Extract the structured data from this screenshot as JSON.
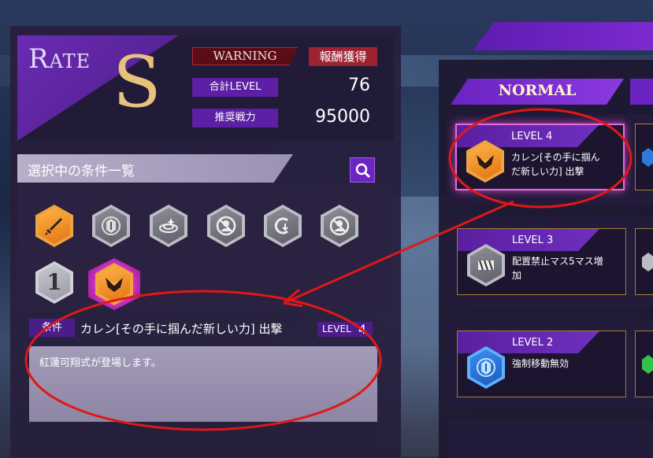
{
  "rate": {
    "label": "Rate",
    "value": "S"
  },
  "warning": "WARNING",
  "reward_button": "報酬獲得",
  "stats": {
    "total_level_label": "合計LEVEL",
    "total_level_value": "76",
    "recommended_power_label": "推奨戦力",
    "recommended_power_value": "95000"
  },
  "conditions": {
    "header": "選択中の条件一覧",
    "icons": [
      "sword-icon",
      "shield-block-icon",
      "swirl-icon",
      "no-unit-icon",
      "recall-icon",
      "no-unit-icon",
      "number-one-icon",
      "guren-icon"
    ],
    "one_label": "1"
  },
  "detail": {
    "tag": "条件",
    "name": "カレン[その手に掴んだ新しい力] 出撃",
    "level_label": "LEVEL",
    "level_value": "4",
    "description": "紅蓮可翔式が登場します。"
  },
  "right": {
    "tab": "NORMAL",
    "cards": [
      {
        "level": "LEVEL 4",
        "text_line1": "カレン[その手に掴ん",
        "text_line2": "だ新しい力] 出撃",
        "icon": "guren-icon"
      },
      {
        "level": "LEVEL 3",
        "text_line1": "配置禁止マス5マス増",
        "text_line2": "加",
        "icon": "barrier-icon"
      },
      {
        "level": "LEVEL 2",
        "text_line1": "強制移動無効",
        "text_line2": "",
        "icon": "shield-block-icon"
      }
    ]
  },
  "colors": {
    "purple": "#6b2bb4",
    "gold": "#e6c27a",
    "warning_red": "#9e2332",
    "selected_pink": "#e56bd8",
    "annotation_red": "#e01818"
  }
}
